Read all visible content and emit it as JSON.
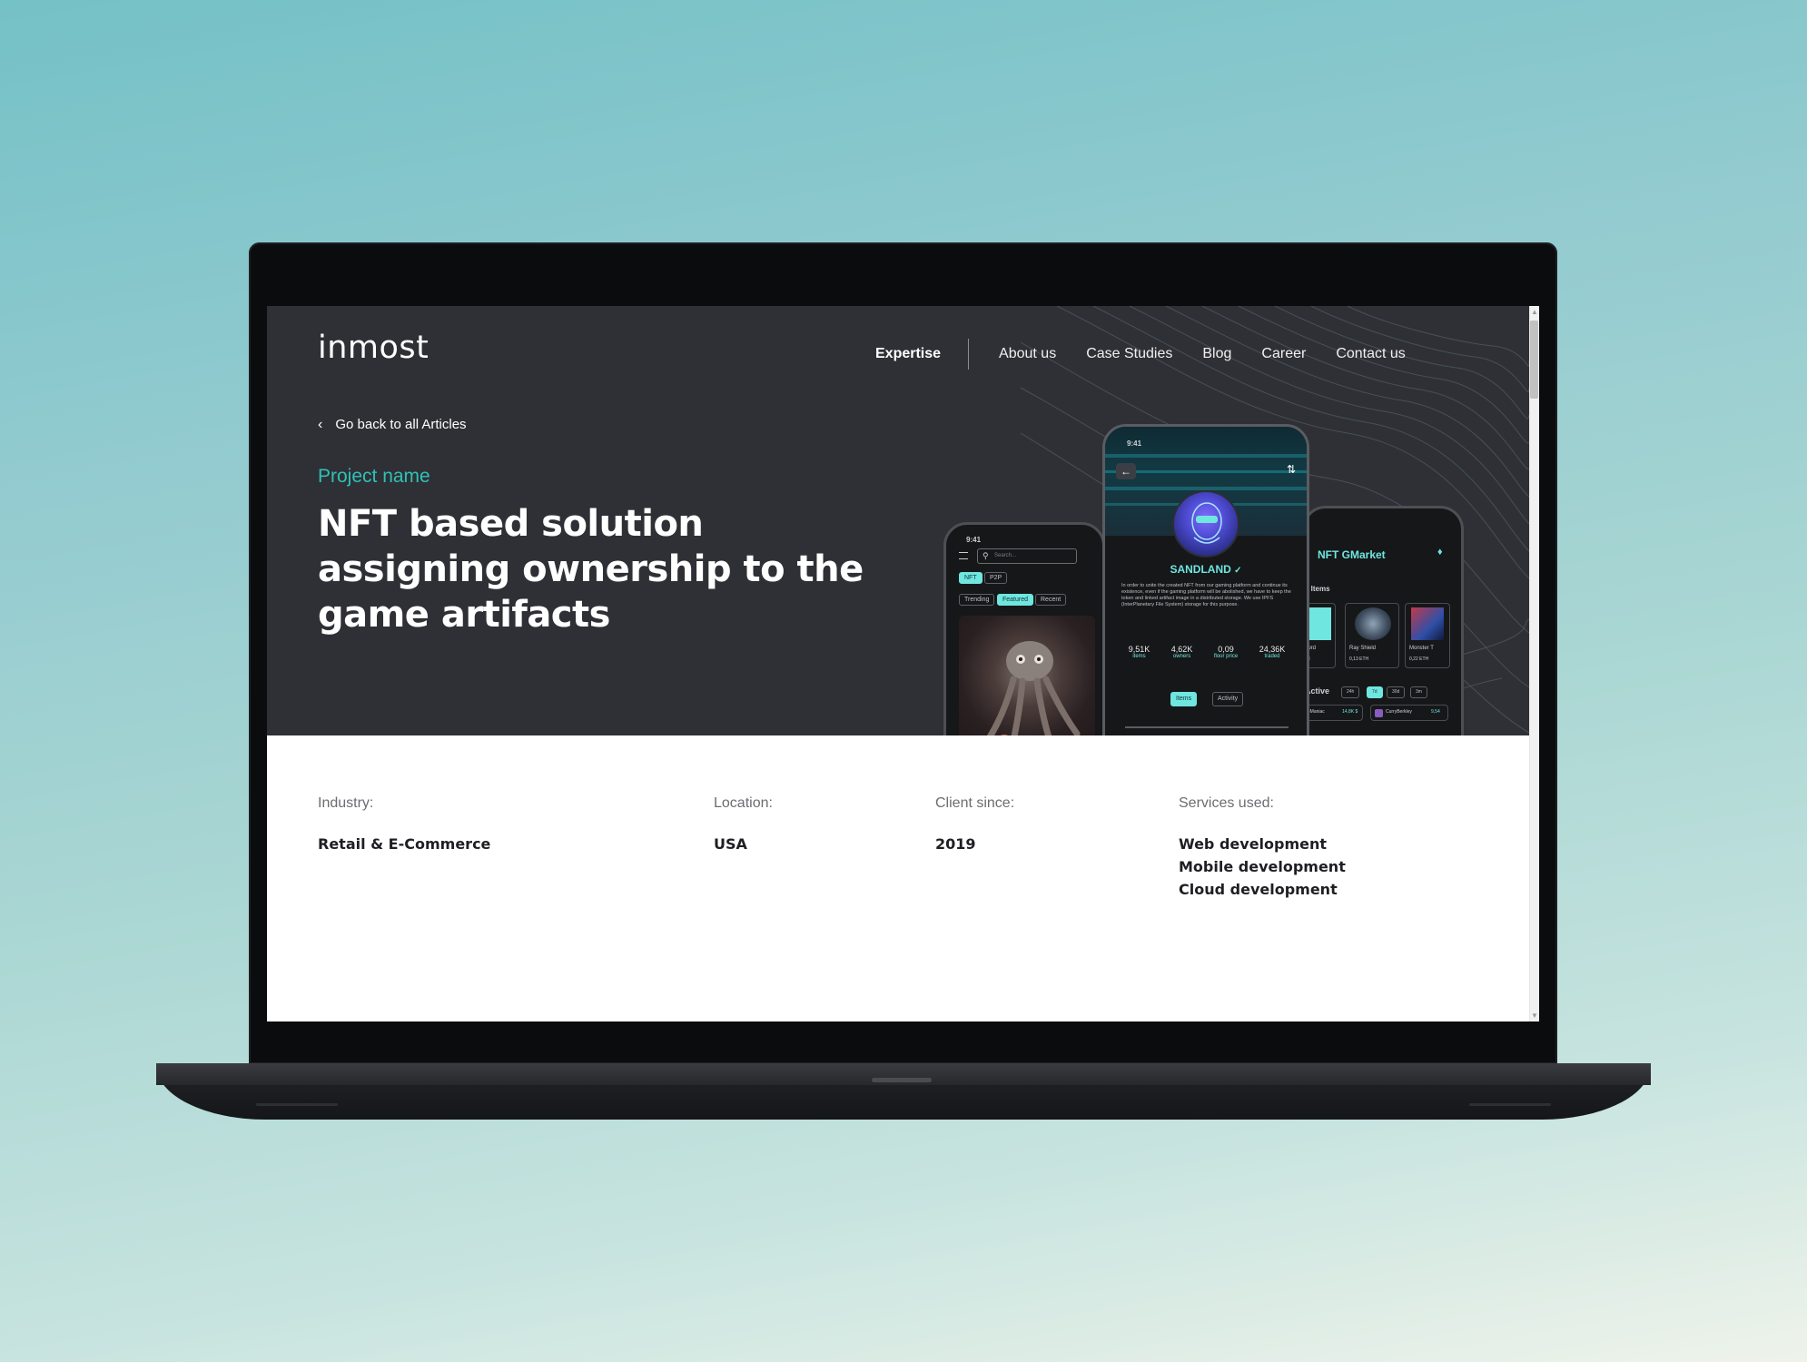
{
  "header": {
    "logo": "inmost",
    "nav": [
      {
        "label": "Expertise",
        "active": true
      },
      {
        "label": "About us"
      },
      {
        "label": "Case Studies"
      },
      {
        "label": "Blog"
      },
      {
        "label": "Career"
      },
      {
        "label": "Contact us"
      }
    ]
  },
  "hero": {
    "back_label": "Go back to all Articles",
    "project_name": "Project name",
    "title": "NFT based solution assigning ownership to the game artifacts"
  },
  "mockups": {
    "left": {
      "time": "9:41",
      "search": "Search...",
      "chips_top": [
        "NFT",
        "P2P"
      ],
      "chips_filter": [
        "Trending",
        "Featured",
        "Recent"
      ]
    },
    "mid": {
      "time": "9:41",
      "name": "SANDLAND",
      "description": "In order to unite the created NFT from our gaming platform and continue its existence, even if the gaming platform will be abolished, we have to keep the token and linked artifact image in a distributed storage. We use IPFS (InterPlanetary File System) storage for this purpose.",
      "stats": [
        {
          "value": "9,51K",
          "label": "items"
        },
        {
          "value": "4,62K",
          "label": "owners"
        },
        {
          "value": "0,09",
          "label": "floor price"
        },
        {
          "value": "24,36K",
          "label": "traded"
        }
      ],
      "tabs": [
        "Items",
        "Activity"
      ]
    },
    "right": {
      "title": "NFT GMarket",
      "section": "e Items",
      "items": [
        {
          "name": "word",
          "price": "TH"
        },
        {
          "name": "Ray Shield",
          "price": "0,13 ETH"
        },
        {
          "name": "Monster T",
          "price": "0,22 ETH"
        }
      ],
      "active_label": "Active",
      "periods": [
        "24h",
        "7d",
        "30d",
        "3m"
      ],
      "traders": [
        {
          "name": "ttleManiac",
          "value": "14,8K $"
        },
        {
          "name": "CurryBerkley",
          "value": "9,54"
        }
      ]
    },
    "accent": "#6fe6e0"
  },
  "details": {
    "industry": {
      "label": "Industry:",
      "value": "Retail & E-Commerce"
    },
    "location": {
      "label": "Location:",
      "value": "USA"
    },
    "client_since": {
      "label": "Client since:",
      "value": "2019"
    },
    "services": {
      "label": "Services used:",
      "values": [
        "Web development",
        "Mobile development",
        "Cloud development"
      ]
    }
  },
  "colors": {
    "accent_teal": "#2fc1b6",
    "hero_bg": "#2f3036"
  }
}
